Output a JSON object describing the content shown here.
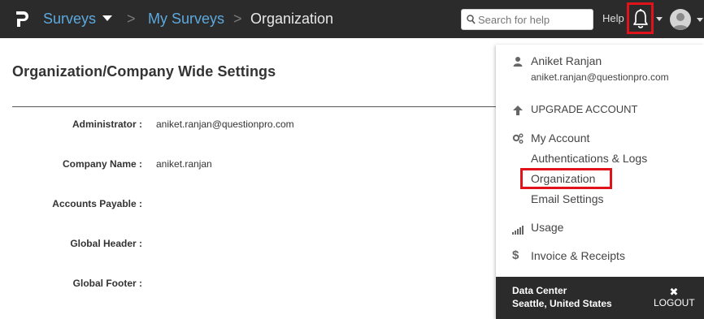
{
  "topbar": {
    "logo_icon": "questionpro-logo-icon",
    "nav": {
      "surveys_label": "Surveys",
      "my_surveys_label": "My Surveys",
      "current_label": "Organization",
      "separator": ">"
    },
    "search": {
      "placeholder": "Search for help",
      "value": ""
    },
    "help_label": "Help",
    "icons": [
      "search-icon",
      "bell-icon",
      "chevron-down-icon",
      "user-avatar-icon"
    ],
    "highlight_color": "#e0131a",
    "link_color": "#5da9de",
    "background": "#2b2b2b"
  },
  "main": {
    "title": "Organization/Company Wide Settings",
    "fields": [
      {
        "label": "Administrator :",
        "value": "aniket.ranjan@questionpro.com"
      },
      {
        "label": "Company Name :",
        "value": "aniket.ranjan"
      },
      {
        "label": "Accounts Payable :",
        "value": ""
      },
      {
        "label": "Global Header :",
        "value": ""
      },
      {
        "label": "Global Footer :",
        "value": ""
      }
    ]
  },
  "account_menu": {
    "user": {
      "name": "Aniket Ranjan",
      "email": "aniket.ranjan@questionpro.com",
      "icon": "user-icon"
    },
    "upgrade": {
      "label": "UPGRADE ACCOUNT",
      "icon": "arrow-up-icon"
    },
    "my_account": {
      "label": "My Account",
      "icon": "gears-icon",
      "items": [
        "Authentications & Logs",
        "Organization",
        "Email Settings"
      ]
    },
    "usage": {
      "label": "Usage",
      "icon": "signal-bars-icon"
    },
    "invoice": {
      "label": "Invoice & Receipts",
      "icon": "dollar-icon"
    },
    "footer": {
      "data_center_label": "Data Center",
      "data_center_location": "Seattle, United States",
      "logout_label": "LOGOUT",
      "logout_icon": "close-icon"
    }
  }
}
